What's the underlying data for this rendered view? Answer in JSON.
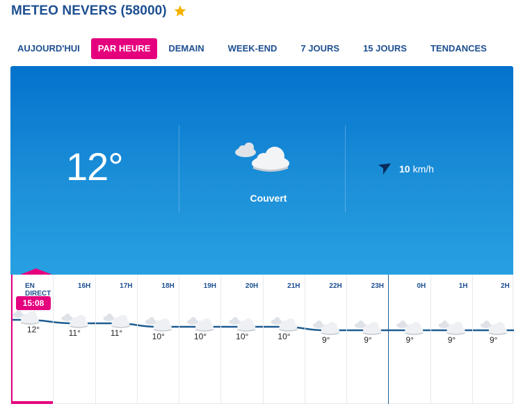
{
  "header": {
    "title": "METEO NEVERS (58000)",
    "favorite_icon": "star-icon",
    "star_color": "#f5b301"
  },
  "tabs": [
    {
      "label": "AUJOURD'HUI",
      "active": false
    },
    {
      "label": "PAR HEURE",
      "active": true
    },
    {
      "label": "DEMAIN",
      "active": false
    },
    {
      "label": "WEEK-END",
      "active": false
    },
    {
      "label": "7 JOURS",
      "active": false
    },
    {
      "label": "15 JOURS",
      "active": false
    },
    {
      "label": "TENDANCES",
      "active": false
    }
  ],
  "current": {
    "temperature": "12°",
    "condition": "Couvert",
    "condition_icon": "cloudy-icon",
    "wind_icon": "wind-direction-arrow-icon",
    "wind_speed": "10",
    "wind_unit": "km/h"
  },
  "hourly": {
    "now_time": "15:08",
    "accent_color": "#e5007e",
    "columns": [
      {
        "hour": "EN DIRECT",
        "temp": "12°",
        "icon": "cloudy-icon"
      },
      {
        "hour": "16H",
        "temp": "11°",
        "icon": "cloudy-icon"
      },
      {
        "hour": "17H",
        "temp": "11°",
        "icon": "cloudy-icon"
      },
      {
        "hour": "18H",
        "temp": "10°",
        "icon": "cloudy-icon"
      },
      {
        "hour": "19H",
        "temp": "10°",
        "icon": "cloudy-icon"
      },
      {
        "hour": "20H",
        "temp": "10°",
        "icon": "cloudy-icon"
      },
      {
        "hour": "21H",
        "temp": "10°",
        "icon": "cloudy-icon"
      },
      {
        "hour": "22H",
        "temp": "9°",
        "icon": "cloudy-icon"
      },
      {
        "hour": "23H",
        "temp": "9°",
        "icon": "cloudy-icon"
      },
      {
        "hour": "0H",
        "temp": "9°",
        "icon": "cloudy-icon"
      },
      {
        "hour": "1H",
        "temp": "9°",
        "icon": "cloudy-icon"
      },
      {
        "hour": "2H",
        "temp": "9°",
        "icon": "cloudy-icon"
      }
    ]
  },
  "chart_data": {
    "type": "line",
    "x": [
      "EN DIRECT",
      "16H",
      "17H",
      "18H",
      "19H",
      "20H",
      "21H",
      "22H",
      "23H",
      "0H",
      "1H",
      "2H"
    ],
    "values": [
      12,
      11,
      11,
      10,
      10,
      10,
      10,
      9,
      9,
      9,
      9,
      9
    ],
    "line_color": "#1d5c91"
  }
}
